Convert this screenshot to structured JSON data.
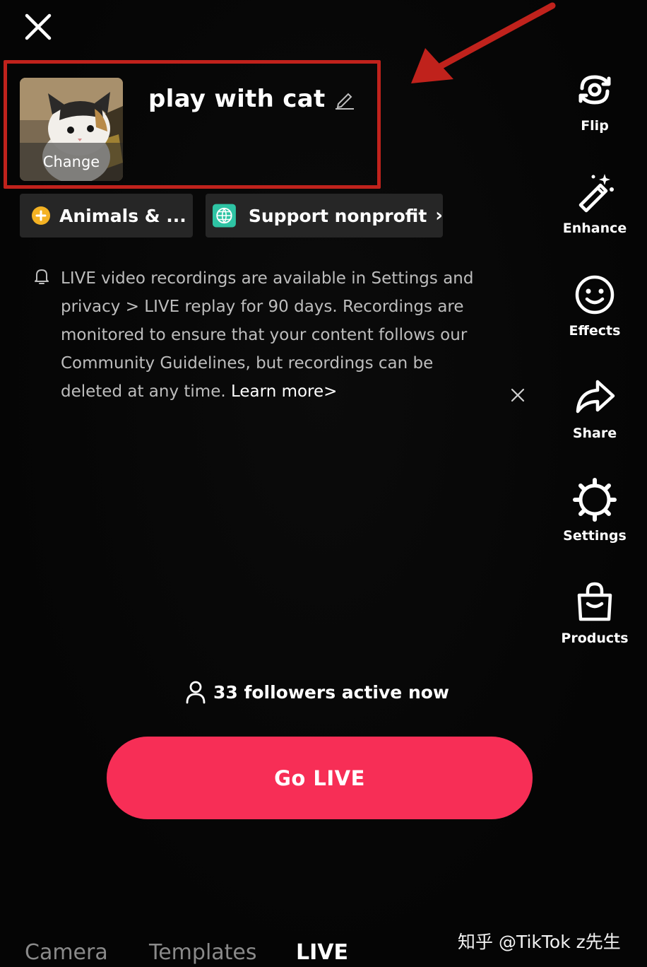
{
  "header": {
    "close_icon": "close-icon"
  },
  "live_setup": {
    "cover": {
      "change_label": "Change"
    },
    "title": "play with cat",
    "edit_icon": "pencil-icon"
  },
  "chips": {
    "category": {
      "label": "Animals & ...",
      "icon": "category-badge-icon",
      "color": "#f4b223"
    },
    "nonprofit": {
      "label": "Support nonprofit",
      "icon": "globe-heart-icon",
      "chevron": "›",
      "color": "#2ec4a4"
    }
  },
  "notice": {
    "text": "LIVE video recordings are available in Settings and privacy > LIVE replay for 90 days. Recordings are monitored to ensure that your content follows our Community Guidelines, but recordings can be deleted at any time.",
    "link": "Learn more>"
  },
  "toolbar": {
    "items": [
      {
        "label": "Flip",
        "icon": "flip-camera-icon"
      },
      {
        "label": "Enhance",
        "icon": "magic-wand-icon"
      },
      {
        "label": "Effects",
        "icon": "smiley-icon"
      },
      {
        "label": "Share",
        "icon": "share-arrow-icon"
      },
      {
        "label": "Settings",
        "icon": "gear-icon"
      },
      {
        "label": "Products",
        "icon": "shopping-bag-icon"
      }
    ]
  },
  "followers": {
    "text": "33 followers active now",
    "icon": "person-icon"
  },
  "go_live": {
    "label": "Go LIVE",
    "color": "#f72e56"
  },
  "tabs": [
    "Camera",
    "Templates",
    "LIVE"
  ],
  "active_tab": "LIVE",
  "watermark": "知乎 @TikTok z先生",
  "annotation": {
    "color": "#c0221c"
  }
}
